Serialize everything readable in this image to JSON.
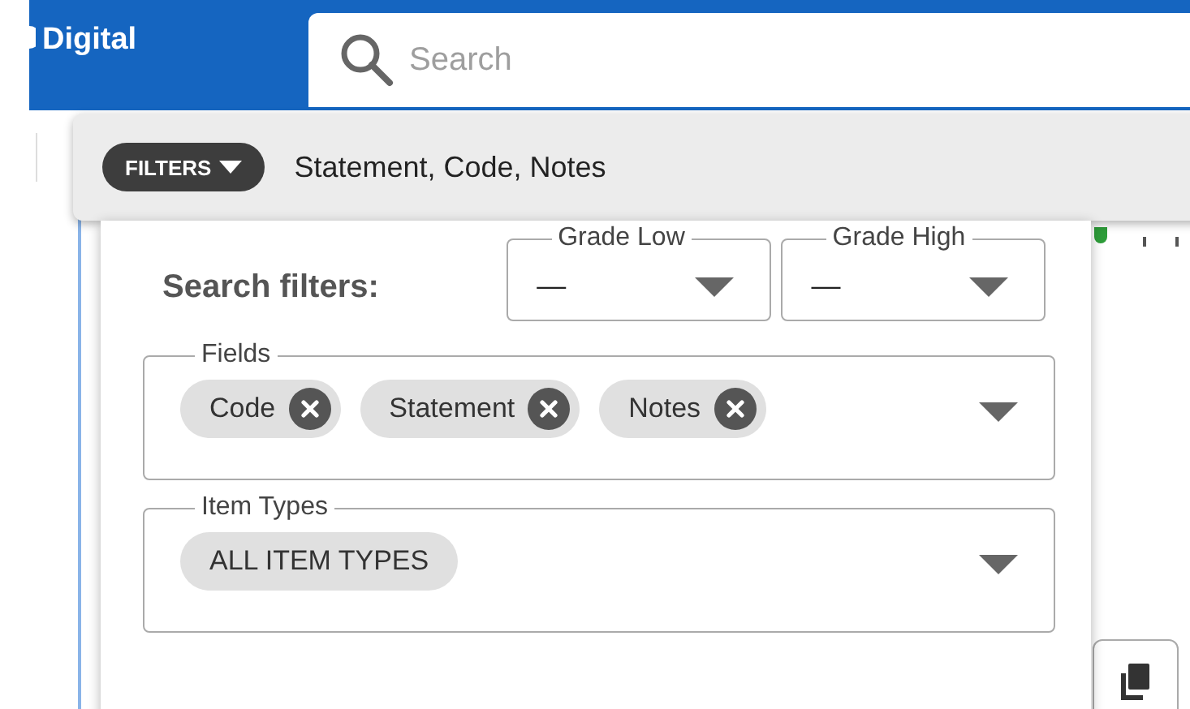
{
  "header": {
    "brand": "Digital",
    "search": {
      "placeholder": "Search"
    }
  },
  "filter_bar": {
    "button": "FILTERS",
    "summary": "Statement, Code, Notes"
  },
  "filter_panel": {
    "title": "Search filters:",
    "selects": [
      {
        "label": "Grade Low",
        "value": "—"
      },
      {
        "label": "Grade High",
        "value": "—"
      }
    ],
    "groups": [
      {
        "label": "Fields",
        "removable": true,
        "chips": [
          "Code",
          "Statement",
          "Notes"
        ]
      },
      {
        "label": "Item Types",
        "removable": false,
        "chips": [
          "ALL ITEM TYPES"
        ]
      }
    ]
  }
}
